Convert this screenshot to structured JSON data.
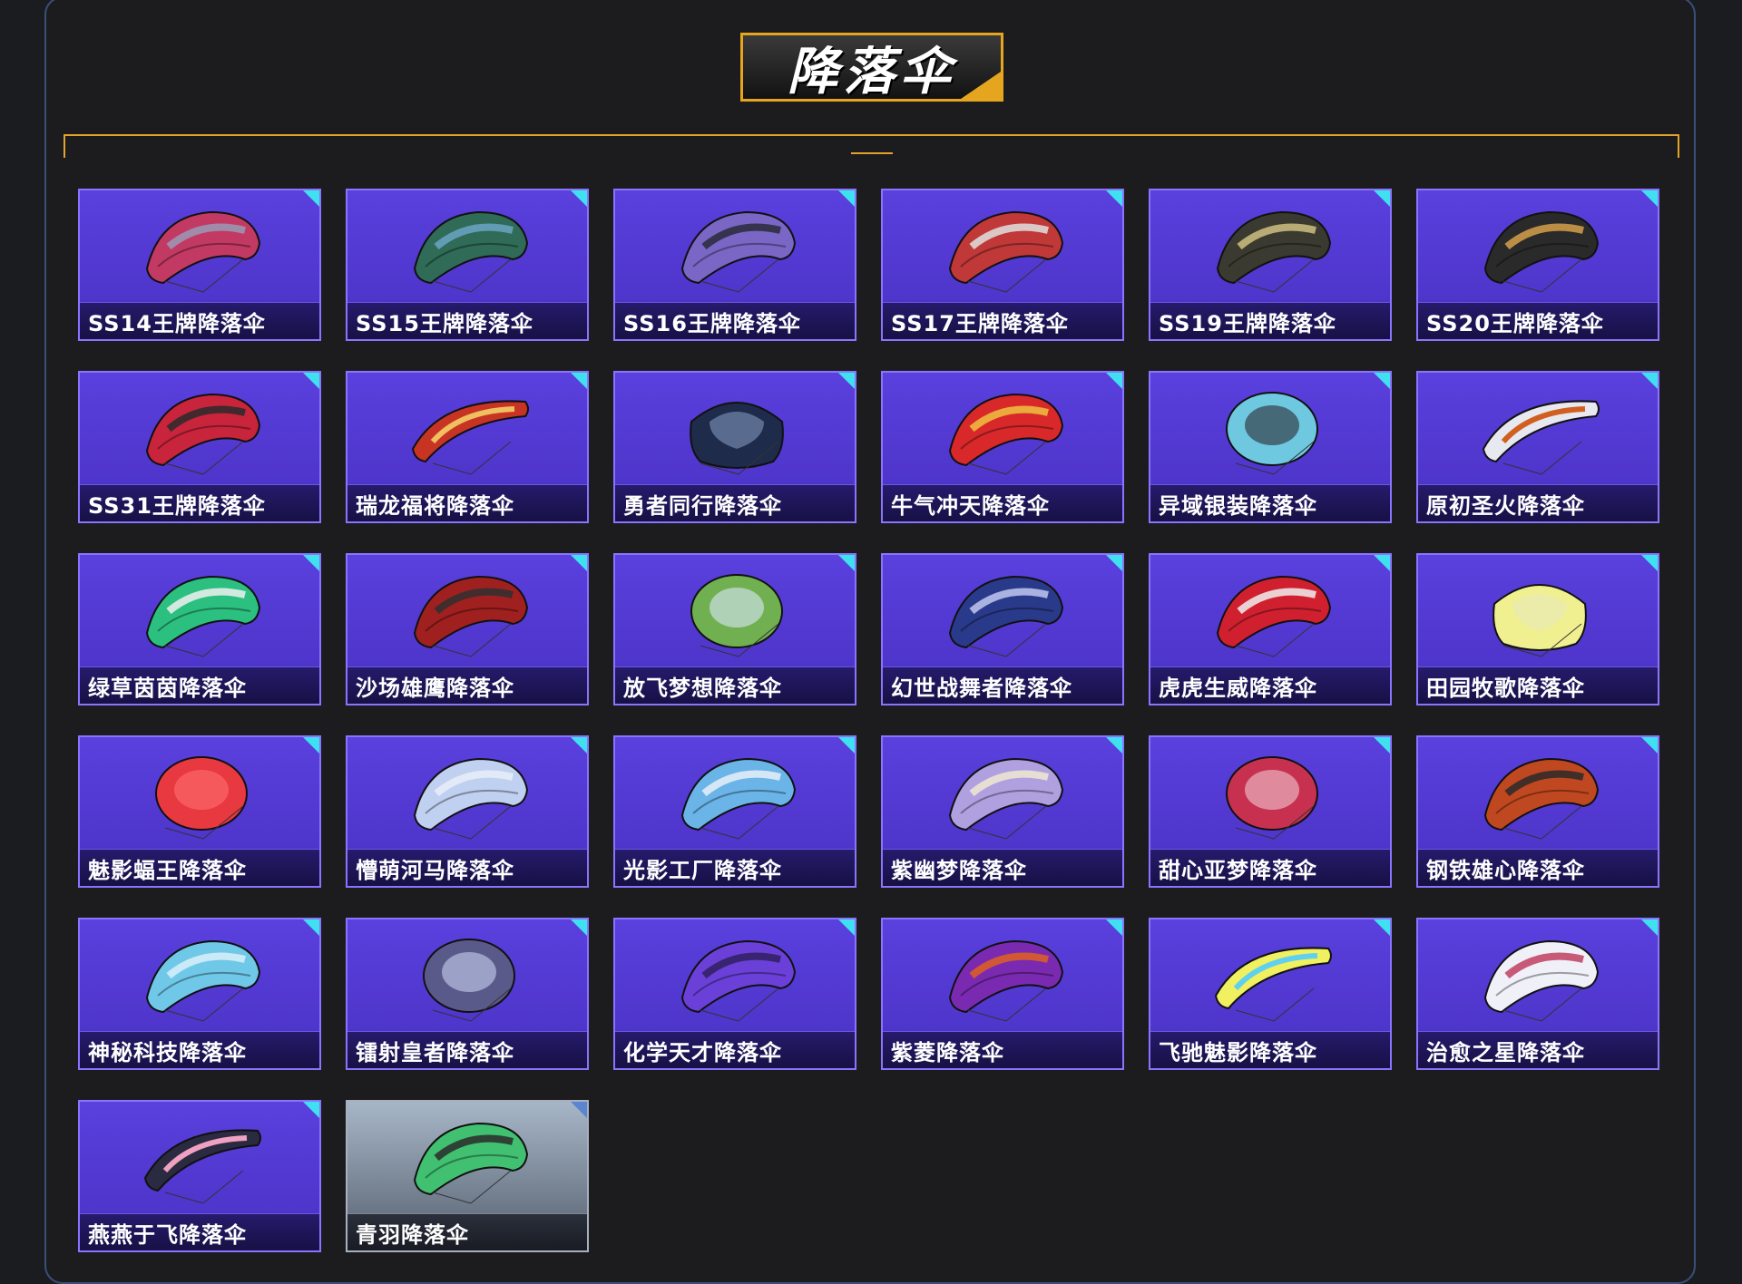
{
  "page": {
    "title": "降落伞"
  },
  "items": [
    {
      "name": "SS14王牌降落伞",
      "colors": [
        "#c23a63",
        "#9a9ab5"
      ],
      "style": "wide"
    },
    {
      "name": "SS15王牌降落伞",
      "colors": [
        "#2f6b56",
        "#6aa4c4"
      ],
      "style": "wide"
    },
    {
      "name": "SS16王牌降落伞",
      "colors": [
        "#7a66c4",
        "#2a2a3a"
      ],
      "style": "wide"
    },
    {
      "name": "SS17王牌降落伞",
      "colors": [
        "#c03838",
        "#e0e0e0"
      ],
      "style": "wide"
    },
    {
      "name": "SS19王牌降落伞",
      "colors": [
        "#3a3a30",
        "#cfc080"
      ],
      "style": "wide"
    },
    {
      "name": "SS20王牌降落伞",
      "colors": [
        "#2a2a2a",
        "#d6a04a"
      ],
      "style": "wide"
    },
    {
      "name": "SS31王牌降落伞",
      "colors": [
        "#c8243c",
        "#2a2a2a"
      ],
      "style": "wide"
    },
    {
      "name": "瑞龙福将降落伞",
      "colors": [
        "#c83424",
        "#f0c060"
      ],
      "style": "thin"
    },
    {
      "name": "勇者同行降落伞",
      "colors": [
        "#1e2b4a",
        "#8aa0c8"
      ],
      "style": "square"
    },
    {
      "name": "牛气冲天降落伞",
      "colors": [
        "#d8282a",
        "#f0c040"
      ],
      "style": "wide"
    },
    {
      "name": "异域银装降落伞",
      "colors": [
        "#6ec8e0",
        "#2a2a30"
      ],
      "style": "round"
    },
    {
      "name": "原初圣火降落伞",
      "colors": [
        "#e8e8f0",
        "#d06020"
      ],
      "style": "thin"
    },
    {
      "name": "绿草茵茵降落伞",
      "colors": [
        "#2cc080",
        "#f0f0f0"
      ],
      "style": "wide"
    },
    {
      "name": "沙场雄鹰降落伞",
      "colors": [
        "#a02020",
        "#303030"
      ],
      "style": "wide"
    },
    {
      "name": "放飞梦想降落伞",
      "colors": [
        "#70b050",
        "#d8e8f8"
      ],
      "style": "round"
    },
    {
      "name": "幻世战舞者降落伞",
      "colors": [
        "#2a3a8a",
        "#c0c8f0"
      ],
      "style": "wide"
    },
    {
      "name": "虎虎生威降落伞",
      "colors": [
        "#d02030",
        "#f0f0f0"
      ],
      "style": "wide"
    },
    {
      "name": "田园牧歌降落伞",
      "colors": [
        "#f0f090",
        "#e8e8c0"
      ],
      "style": "square"
    },
    {
      "name": "魅影蝠王降落伞",
      "colors": [
        "#e83840",
        "#ff7070"
      ],
      "style": "round"
    },
    {
      "name": "懵萌河马降落伞",
      "colors": [
        "#c0d0f0",
        "#e8eef8"
      ],
      "style": "wide"
    },
    {
      "name": "光影工厂降落伞",
      "colors": [
        "#6ab4e8",
        "#e8f0f8"
      ],
      "style": "wide"
    },
    {
      "name": "紫幽梦降落伞",
      "colors": [
        "#b0a0e0",
        "#f0e8d0"
      ],
      "style": "wide"
    },
    {
      "name": "甜心亚梦降落伞",
      "colors": [
        "#c83050",
        "#f0c8d0"
      ],
      "style": "round"
    },
    {
      "name": "钢铁雄心降落伞",
      "colors": [
        "#c04820",
        "#2a2a2a"
      ],
      "style": "wide"
    },
    {
      "name": "神秘科技降落伞",
      "colors": [
        "#70c8e8",
        "#d8f0f8"
      ],
      "style": "wide"
    },
    {
      "name": "镭射皇者降落伞",
      "colors": [
        "#5a5a8a",
        "#c8d0f0"
      ],
      "style": "round"
    },
    {
      "name": "化学天才降落伞",
      "colors": [
        "#6a40d8",
        "#302060"
      ],
      "style": "wide"
    },
    {
      "name": "紫菱降落伞",
      "colors": [
        "#7a2ab0",
        "#e06020"
      ],
      "style": "wide"
    },
    {
      "name": "飞驰魅影降落伞",
      "colors": [
        "#f0f060",
        "#60d0f0"
      ],
      "style": "thin"
    },
    {
      "name": "治愈之星降落伞",
      "colors": [
        "#f0f0f8",
        "#c04060"
      ],
      "style": "wide"
    },
    {
      "name": "燕燕于飞降落伞",
      "colors": [
        "#2a2a40",
        "#f0a0c0"
      ],
      "style": "thin"
    },
    {
      "name": "青羽降落伞",
      "colors": [
        "#40c070",
        "#2a2a2a"
      ],
      "style": "wide",
      "rarity": "grey"
    }
  ],
  "accent_colors": {
    "gold": "#e5a51f",
    "card": "#5a40dd",
    "corner": "#3fe0f0"
  }
}
